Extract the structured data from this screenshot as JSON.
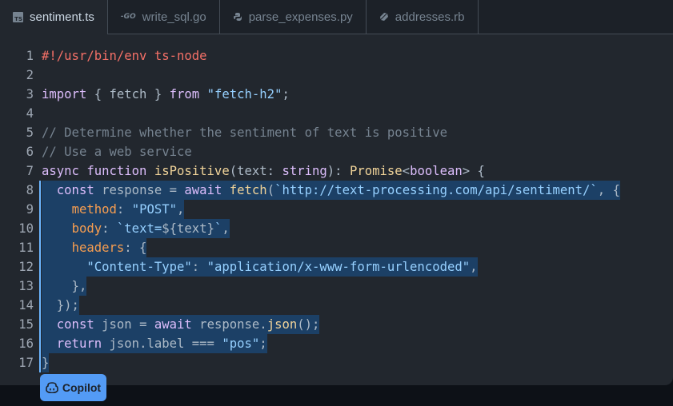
{
  "tabs": [
    {
      "label": "sentiment.ts",
      "icon": "typescript-icon",
      "icon_text": "TS",
      "active": true
    },
    {
      "label": "write_sql.go",
      "icon": "go-icon",
      "icon_text": "-GO",
      "active": false
    },
    {
      "label": "parse_expenses.py",
      "icon": "python-icon",
      "active": false
    },
    {
      "label": "addresses.rb",
      "icon": "ruby-icon",
      "active": false
    }
  ],
  "editor": {
    "line_numbers": [
      "1",
      "2",
      "3",
      "4",
      "5",
      "6",
      "7",
      "8",
      "9",
      "10",
      "11",
      "12",
      "13",
      "14",
      "15",
      "16",
      "17"
    ],
    "highlighted_lines": [
      8,
      9,
      10,
      11,
      12,
      13,
      14,
      15,
      16,
      17
    ]
  },
  "copilot": {
    "label": "Copilot"
  },
  "colors": {
    "background": "#22272e",
    "selection": "#1c4066",
    "keyword": "#dcbdfb",
    "string": "#96d0ff",
    "comment": "#768390",
    "accent": "#539bf5"
  }
}
